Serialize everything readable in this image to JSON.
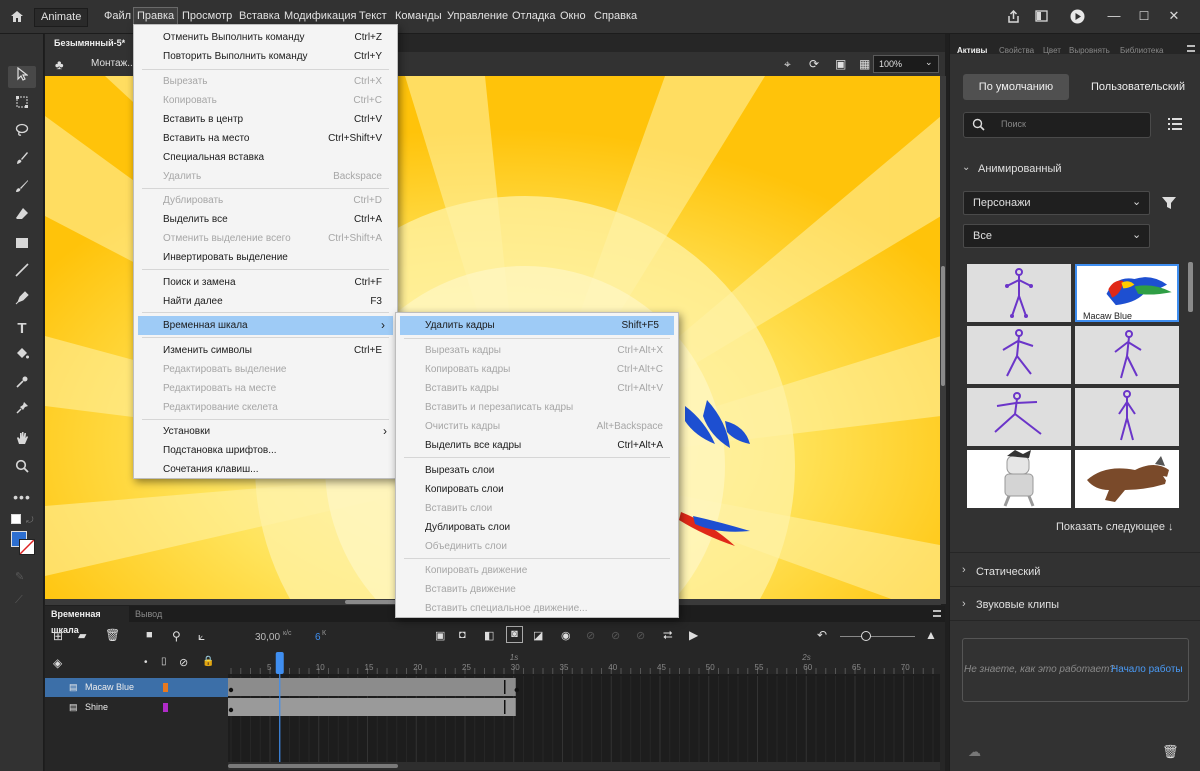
{
  "menubar": {
    "app_name": "Animate",
    "items": [
      "Файл",
      "Правка",
      "Просмотр",
      "Вставка",
      "Модификация",
      "Текст",
      "Команды",
      "Управление",
      "Отладка",
      "Окно",
      "Справка"
    ]
  },
  "document": {
    "tab_title": "Безымянный-5*",
    "scene_label": "Монтаж...",
    "zoom": "100%"
  },
  "edit_menu": {
    "items": [
      {
        "label": "Отменить Выполнить команду",
        "shortcut": "Ctrl+Z",
        "enabled": true
      },
      {
        "label": "Повторить Выполнить команду",
        "shortcut": "Ctrl+Y",
        "enabled": true
      },
      {
        "label": "Вырезать",
        "shortcut": "Ctrl+X",
        "enabled": false
      },
      {
        "label": "Копировать",
        "shortcut": "Ctrl+C",
        "enabled": false
      },
      {
        "label": "Вставить в центр",
        "shortcut": "Ctrl+V",
        "enabled": true
      },
      {
        "label": "Вставить на место",
        "shortcut": "Ctrl+Shift+V",
        "enabled": true
      },
      {
        "label": "Специальная вставка",
        "shortcut": "",
        "enabled": true
      },
      {
        "label": "Удалить",
        "shortcut": "Backspace",
        "enabled": false
      },
      {
        "label": "Дублировать",
        "shortcut": "Ctrl+D",
        "enabled": false
      },
      {
        "label": "Выделить все",
        "shortcut": "Ctrl+A",
        "enabled": true
      },
      {
        "label": "Отменить выделение всего",
        "shortcut": "Ctrl+Shift+A",
        "enabled": false
      },
      {
        "label": "Инвертировать выделение",
        "shortcut": "",
        "enabled": true
      },
      {
        "label": "Поиск и замена",
        "shortcut": "Ctrl+F",
        "enabled": true
      },
      {
        "label": "Найти далее",
        "shortcut": "F3",
        "enabled": true
      },
      {
        "label": "Временная шкала",
        "shortcut": "›",
        "enabled": true
      },
      {
        "label": "Изменить символы",
        "shortcut": "Ctrl+E",
        "enabled": true
      },
      {
        "label": "Редактировать выделение",
        "shortcut": "",
        "enabled": false
      },
      {
        "label": "Редактировать на месте",
        "shortcut": "",
        "enabled": false
      },
      {
        "label": "Редактирование скелета",
        "shortcut": "",
        "enabled": false
      },
      {
        "label": "Установки",
        "shortcut": "›",
        "enabled": true
      },
      {
        "label": "Подстановка шрифтов...",
        "shortcut": "",
        "enabled": true
      },
      {
        "label": "Сочетания клавиш...",
        "shortcut": "",
        "enabled": true
      }
    ]
  },
  "timeline_submenu": {
    "items": [
      {
        "label": "Удалить кадры",
        "shortcut": "Shift+F5",
        "enabled": true
      },
      {
        "label": "Вырезать кадры",
        "shortcut": "Ctrl+Alt+X",
        "enabled": false
      },
      {
        "label": "Копировать кадры",
        "shortcut": "Ctrl+Alt+C",
        "enabled": false
      },
      {
        "label": "Вставить кадры",
        "shortcut": "Ctrl+Alt+V",
        "enabled": false
      },
      {
        "label": "Вставить и перезаписать кадры",
        "shortcut": "",
        "enabled": false
      },
      {
        "label": "Очистить кадры",
        "shortcut": "Alt+Backspace",
        "enabled": false
      },
      {
        "label": "Выделить все кадры",
        "shortcut": "Ctrl+Alt+A",
        "enabled": true
      },
      {
        "label": "Вырезать слои",
        "shortcut": "",
        "enabled": true
      },
      {
        "label": "Копировать слои",
        "shortcut": "",
        "enabled": true
      },
      {
        "label": "Вставить слои",
        "shortcut": "",
        "enabled": false
      },
      {
        "label": "Дублировать слои",
        "shortcut": "",
        "enabled": true
      },
      {
        "label": "Объединить слои",
        "shortcut": "",
        "enabled": false
      },
      {
        "label": "Копировать движение",
        "shortcut": "",
        "enabled": false
      },
      {
        "label": "Вставить движение",
        "shortcut": "",
        "enabled": false
      },
      {
        "label": "Вставить специальное движение...",
        "shortcut": "",
        "enabled": false
      }
    ]
  },
  "timeline": {
    "tab_active": "Временная шкала",
    "tab_inactive": "Вывод",
    "fps": "30,00",
    "fps_unit": "к/с",
    "current_frame": "6",
    "frame_unit": "К",
    "ruler_ticks": [
      "5",
      "10",
      "15",
      "20",
      "25",
      "30",
      "35",
      "40",
      "45",
      "50",
      "55",
      "60",
      "65",
      "70"
    ],
    "seconds_labels": [
      "1s",
      "2s"
    ],
    "layers": [
      {
        "name": "Macaw Blue",
        "color": "#e8791e",
        "selected": true
      },
      {
        "name": "Shine",
        "color": "#b02bc8",
        "selected": false
      }
    ]
  },
  "assets_panel": {
    "tabs": [
      "Активы",
      "Свойства",
      "Цвет",
      "Выровнять",
      "Библиотека"
    ],
    "btn_default": "По умолчанию",
    "btn_custom": "Пользовательский",
    "search_placeholder": "Поиск",
    "section_animated": "Анимированный",
    "dropdown_category": "Персонажи",
    "dropdown_filter": "Все",
    "macaw_label": "Macaw Blue",
    "show_more": "Показать следующее ↓",
    "section_static": "Статический",
    "section_sound": "Звуковые клипы",
    "help_text": "Не знаете, как это работает?",
    "help_link": "Начало работы"
  },
  "colors": {
    "accent": "#2d6fd1",
    "highlight": "#9ecbf6",
    "stage_yellow": "#ffc812"
  }
}
